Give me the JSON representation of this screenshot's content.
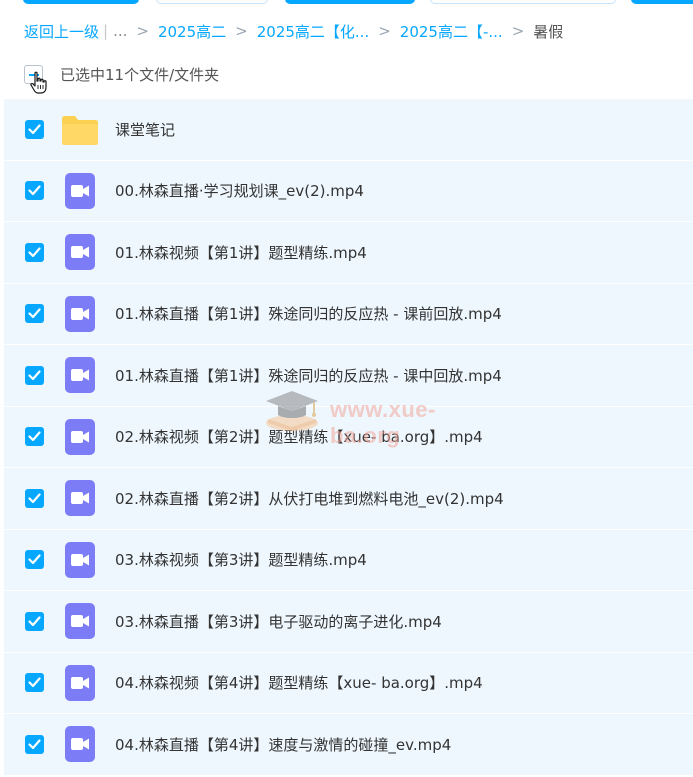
{
  "breadcrumb": {
    "back_label": "返回上一级",
    "ellipsis": "...",
    "items": [
      "2025高二",
      "2025高二【化...",
      "2025高二【-..."
    ],
    "current": "暑假"
  },
  "selection": {
    "text": "已选中11个文件/文件夹"
  },
  "files": [
    {
      "name": "课堂笔记",
      "type": "folder"
    },
    {
      "name": "00.林森直播·学习规划课_ev(2).mp4",
      "type": "video"
    },
    {
      "name": "01.林森视频【第1讲】题型精练.mp4",
      "type": "video"
    },
    {
      "name": "01.林森直播【第1讲】殊途同归的反应热 - 课前回放.mp4",
      "type": "video"
    },
    {
      "name": "01.林森直播【第1讲】殊途同归的反应热 - 课中回放.mp4",
      "type": "video"
    },
    {
      "name": "02.林森视频【第2讲】题型精练【xue- ba.org】.mp4",
      "type": "video"
    },
    {
      "name": "02.林森直播【第2讲】从伏打电堆到燃料电池_ev(2).mp4",
      "type": "video"
    },
    {
      "name": "03.林森视频【第3讲】题型精练.mp4",
      "type": "video"
    },
    {
      "name": "03.林森直播【第3讲】电子驱动的离子进化.mp4",
      "type": "video"
    },
    {
      "name": "04.林森视频【第4讲】题型精练【xue- ba.org】.mp4",
      "type": "video"
    },
    {
      "name": "04.林森直播【第4讲】速度与激情的碰撞_ev.mp4",
      "type": "video"
    }
  ],
  "watermark": {
    "text": "www.xue-ba.org"
  },
  "colors": {
    "accent": "#06a7ff",
    "row_bg": "#eef7fe",
    "folder": "#fcd152",
    "video": "#7b7cf6"
  }
}
